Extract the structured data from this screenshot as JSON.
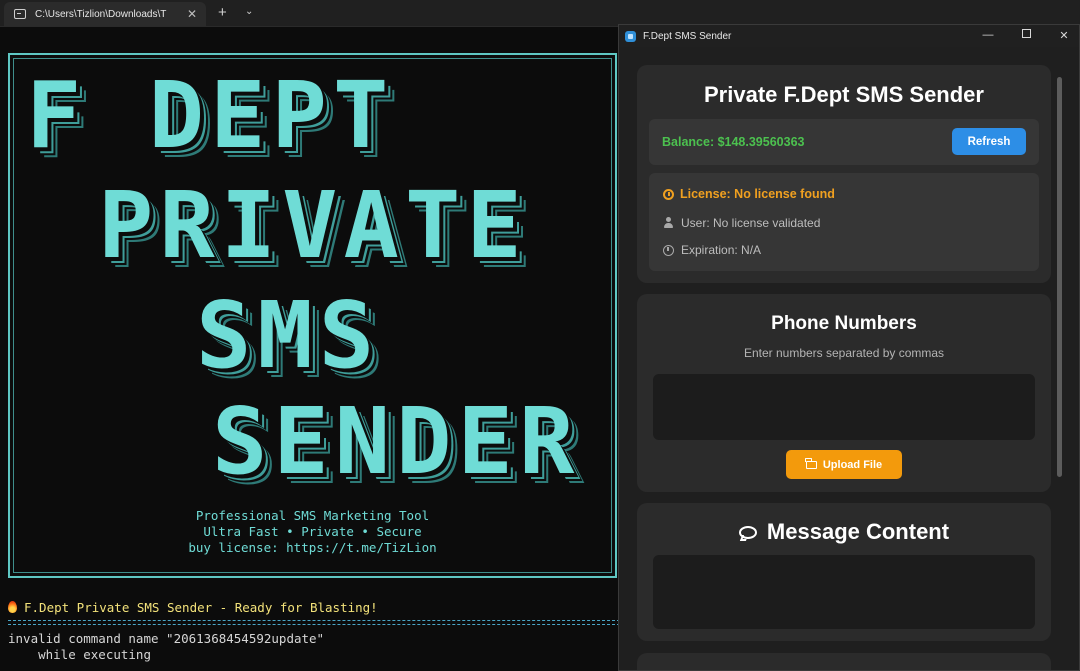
{
  "terminal": {
    "tab_title": "C:\\Users\\Tizlion\\Downloads\\T",
    "tab_close": "✕",
    "new_tab": "+",
    "dropdown": "⌄",
    "banner_lines": [
      "F DEPT",
      "PRIVATE",
      "SMS",
      "SENDER"
    ],
    "subtitle": [
      "Professional SMS Marketing Tool",
      "Ultra Fast • Private • Secure",
      "buy license: https://t.me/TizLion"
    ],
    "status": "F.Dept Private SMS Sender - Ready for Blasting!",
    "output": [
      "invalid command name \"2061368454592update\"",
      "    while executing"
    ]
  },
  "app": {
    "window_title": "F.Dept SMS Sender",
    "controls": {
      "minimize": "—",
      "close": "✕"
    },
    "header": {
      "title": "Private F.Dept SMS Sender",
      "balance": "Balance: $148.39560363",
      "refresh_label": "Refresh",
      "license_title": "License: No license found",
      "user_text": "User: No license validated",
      "expiration_text": "Expiration: N/A"
    },
    "phone": {
      "title": "Phone Numbers",
      "subtitle": "Enter numbers separated by commas",
      "value": "",
      "upload_label": "Upload File"
    },
    "message": {
      "title": "Message Content",
      "value": ""
    },
    "colors": {
      "accent_blue": "#2d8ee6",
      "accent_orange": "#f39a0c",
      "balance_green": "#4cc14f",
      "license_orange": "#f0a020",
      "terminal_cyan": "#6fdcd6"
    }
  }
}
